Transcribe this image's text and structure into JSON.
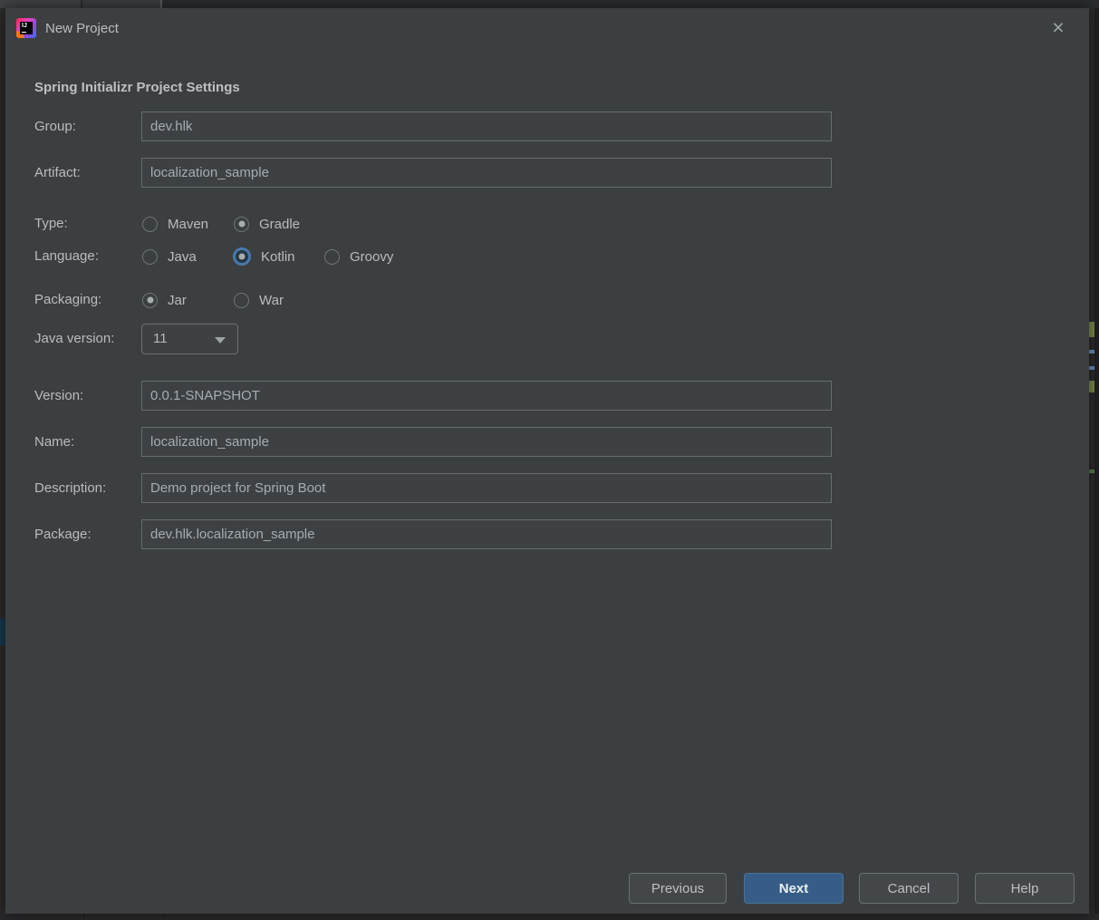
{
  "window": {
    "title": "New Project",
    "close_icon": "×",
    "app_icon": "intellij-idea-logo",
    "app_icon_text": "IJ"
  },
  "heading": "Spring Initializr Project Settings",
  "fields": {
    "group": {
      "label": "Group:",
      "value": "dev.hlk"
    },
    "artifact": {
      "label": "Artifact:",
      "value": "localization_sample"
    },
    "type": {
      "label": "Type:",
      "options": [
        {
          "label": "Maven",
          "selected": false
        },
        {
          "label": "Gradle",
          "selected": true
        }
      ]
    },
    "language": {
      "label": "Language:",
      "options": [
        {
          "label": "Java",
          "selected": false
        },
        {
          "label": "Kotlin",
          "selected": true,
          "focused": true
        },
        {
          "label": "Groovy",
          "selected": false
        }
      ]
    },
    "packaging": {
      "label": "Packaging:",
      "options": [
        {
          "label": "Jar",
          "selected": true
        },
        {
          "label": "War",
          "selected": false
        }
      ]
    },
    "java_version": {
      "label": "Java version:",
      "value": "11"
    },
    "version": {
      "label": "Version:",
      "value": "0.0.1-SNAPSHOT"
    },
    "name": {
      "label": "Name:",
      "value": "localization_sample"
    },
    "description": {
      "label": "Description:",
      "value": "Demo project for Spring Boot"
    },
    "package": {
      "label": "Package:",
      "value": "dev.hlk.localization_sample"
    }
  },
  "buttons": {
    "previous": "Previous",
    "next": "Next",
    "cancel": "Cancel",
    "help": "Help"
  },
  "colors": {
    "dialog_bg": "#3c3f41",
    "outer_bg": "#2b2b2b",
    "primary_button_blue": "#375d86",
    "focus_ring_blue": "#4879aa",
    "field_border": "#666c6f",
    "text": "#b9bcbe"
  }
}
